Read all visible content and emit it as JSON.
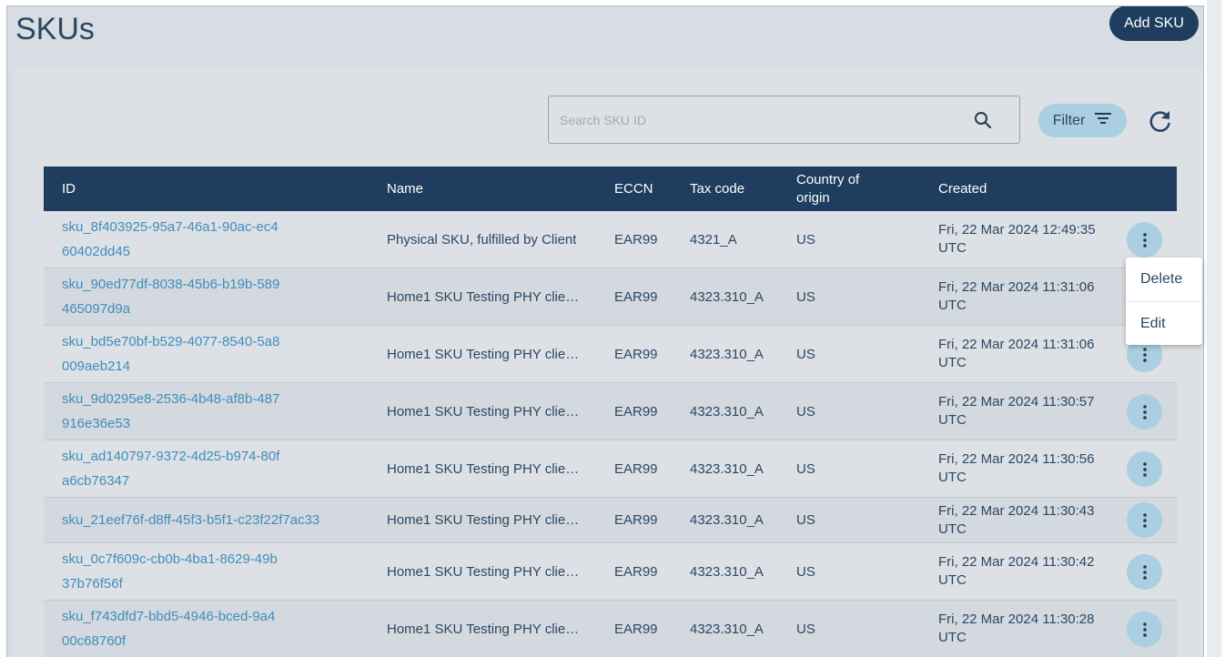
{
  "page": {
    "title": "SKUs",
    "add_button_label": "Add SKU"
  },
  "toolbar": {
    "search_placeholder": "Search SKU ID",
    "search_icon": "search-icon",
    "filter_label": "Filter",
    "filter_icon": "filter-lines-icon",
    "refresh_icon": "refresh-icon"
  },
  "table": {
    "columns": {
      "id": "ID",
      "name": "Name",
      "eccn": "ECCN",
      "tax": "Tax code",
      "country": "Country of origin",
      "created": "Created"
    },
    "rows": [
      {
        "id": "sku_8f403925-95a7-46a1-90ac-ec460402dd45",
        "name": "Physical SKU, fulfilled by Client",
        "eccn": "EAR99",
        "tax": "4321_A",
        "country": "US",
        "created": "Fri, 22 Mar 2024 12:49:35 UTC"
      },
      {
        "id": "sku_90ed77df-8038-45b6-b19b-589465097d9a",
        "name": "Home1 SKU Testing PHY client...",
        "eccn": "EAR99",
        "tax": "4323.310_A",
        "country": "US",
        "created": "Fri, 22 Mar 2024 11:31:06 UTC"
      },
      {
        "id": "sku_bd5e70bf-b529-4077-8540-5a8009aeb214",
        "name": "Home1 SKU Testing PHY client...",
        "eccn": "EAR99",
        "tax": "4323.310_A",
        "country": "US",
        "created": "Fri, 22 Mar 2024 11:31:06 UTC"
      },
      {
        "id": "sku_9d0295e8-2536-4b48-af8b-487916e36e53",
        "name": "Home1 SKU Testing PHY client...",
        "eccn": "EAR99",
        "tax": "4323.310_A",
        "country": "US",
        "created": "Fri, 22 Mar 2024 11:30:57 UTC"
      },
      {
        "id": "sku_ad140797-9372-4d25-b974-80fa6cb76347",
        "name": "Home1 SKU Testing PHY client...",
        "eccn": "EAR99",
        "tax": "4323.310_A",
        "country": "US",
        "created": "Fri, 22 Mar 2024 11:30:56 UTC"
      },
      {
        "id": "sku_21eef76f-d8ff-45f3-b5f1-c23f22f7ac33",
        "name": "Home1 SKU Testing PHY client...",
        "eccn": "EAR99",
        "tax": "4323.310_A",
        "country": "US",
        "created": "Fri, 22 Mar 2024 11:30:43 UTC"
      },
      {
        "id": "sku_0c7f609c-cb0b-4ba1-8629-49b37b76f56f",
        "name": "Home1 SKU Testing PHY client...",
        "eccn": "EAR99",
        "tax": "4323.310_A",
        "country": "US",
        "created": "Fri, 22 Mar 2024 11:30:42 UTC"
      },
      {
        "id": "sku_f743dfd7-bbd5-4946-bced-9a400c68760f",
        "name": "Home1 SKU Testing PHY client...",
        "eccn": "EAR99",
        "tax": "4323.310_A",
        "country": "US",
        "created": "Fri, 22 Mar 2024 11:30:28 UTC"
      }
    ]
  },
  "context_menu": {
    "delete_label": "Delete",
    "edit_label": "Edit"
  },
  "colors": {
    "header": "#1f3d5e",
    "link": "#3f8dbd",
    "accent_light": "#a9cfe0",
    "page_bg": "#d7dde2"
  }
}
